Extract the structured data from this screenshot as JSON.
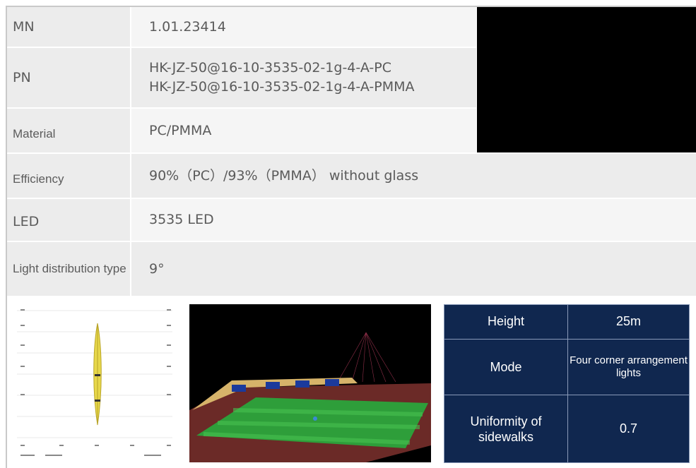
{
  "spec_rows": [
    {
      "label": "MN",
      "values": [
        "1.01.23414"
      ]
    },
    {
      "label": "PN",
      "values": [
        "HK-JZ-50@16-10-3535-02-1g-4-A-PC",
        "HK-JZ-50@16-10-3535-02-1g-4-A-PMMA"
      ]
    },
    {
      "label": "Material",
      "values": [
        "PC/PMMA"
      ]
    },
    {
      "label": "Efficiency",
      "values": [
        "90%（PC）/93%（PMMA） without glass"
      ]
    },
    {
      "label": "LED",
      "values": [
        "3535 LED"
      ]
    },
    {
      "label": "Light distribution type",
      "values": [
        "9°"
      ]
    }
  ],
  "application": {
    "height_label": "Height",
    "height_value": "25m",
    "mode_label": "Mode",
    "mode_value": "Four corner arrangement lights",
    "uniformity_label": "Uniformity of sidewalks",
    "uniformity_value": "0.7"
  }
}
